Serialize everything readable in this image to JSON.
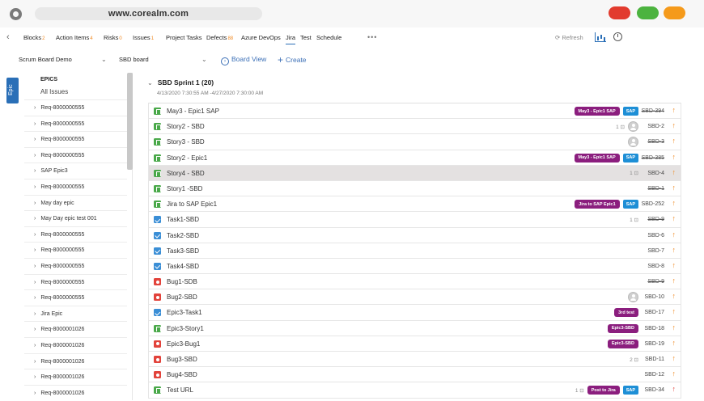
{
  "browser": {
    "url": "www.corealm.com"
  },
  "nav": {
    "back": "‹",
    "tabs": [
      {
        "label": "Blocks",
        "count": "2"
      },
      {
        "label": "Action Items",
        "count": "4"
      },
      {
        "label": "Risks",
        "count": "0"
      },
      {
        "label": "Issues",
        "count": "1"
      },
      {
        "label": "Project Tasks",
        "count": ""
      },
      {
        "label": "Defects",
        "count": "88"
      },
      {
        "label": "Azure DevOps",
        "count": ""
      },
      {
        "label": "Jira",
        "count": ""
      },
      {
        "label": "Test",
        "count": ""
      },
      {
        "label": "Schedule",
        "count": ""
      }
    ],
    "active_tab": "Jira",
    "more": "•••",
    "refresh": "Refresh"
  },
  "toolbar": {
    "project": "Scrum Board Demo",
    "board": "SBD board",
    "board_view": "Board View",
    "create": "Create"
  },
  "side_tab": "Epic",
  "epics": {
    "header": "EPICS",
    "all": "All Issues",
    "items": [
      "Req-8000000555",
      "Req-8000000555",
      "Req-8000000555",
      "Req-8000000555",
      "SAP Epic3",
      "Req-8000000555",
      "May day epic",
      "May Day epic test 001",
      "Req-8000000555",
      "Req-8000000555",
      "Req-8000000555",
      "Req-8000000555",
      "Req-8000000555",
      "Jira Epic",
      "Req-8000001026",
      "Req-8000001026",
      "Req-8000001026",
      "Req-8000001026",
      "Req-8000001026"
    ]
  },
  "sprint": {
    "title": "SBD Sprint 1 (20)",
    "dates": "4/13/2020 7:30:55 AM -4/27/2020 7:30:00 AM"
  },
  "issues": [
    {
      "type": "story",
      "summary": "May3 - Epic1 SAP",
      "epic": "May3 - Epic1 SAP",
      "sap": "SAP",
      "key": "SBD-394",
      "done": true,
      "prio": "↑"
    },
    {
      "type": "story",
      "summary": "Story2 - SBD",
      "sub": "1 ⊡",
      "avatar": true,
      "key": "SBD-2",
      "prio": "↑"
    },
    {
      "type": "story",
      "summary": "Story3 - SBD",
      "avatar": true,
      "key": "SBD-3",
      "done": true,
      "prio": "↑"
    },
    {
      "type": "story",
      "summary": "Story2 - Epic1",
      "epic": "May3 - Epic1 SAP",
      "sap": "SAP",
      "key": "SBD-385",
      "done": true,
      "prio": "↑"
    },
    {
      "type": "story",
      "summary": "Story4 - SBD",
      "sub": "1 ⊡",
      "key": "SBD-4",
      "prio": "↑",
      "selected": true
    },
    {
      "type": "story",
      "summary": "Story1 -SBD",
      "key": "SBD-1",
      "done": true,
      "prio": "↑"
    },
    {
      "type": "story",
      "summary": "Jira to SAP Epic1",
      "epic": "Jira to SAP Epic1",
      "sap": "SAP",
      "key": "SBD-252",
      "prio": "↑"
    },
    {
      "type": "task",
      "summary": "Task1-SBD",
      "sub": "1 ⊡",
      "key": "SBD-9",
      "done": true,
      "prio": "↑"
    },
    {
      "type": "task",
      "summary": "Task2-SBD",
      "key": "SBD-6",
      "prio": "↑"
    },
    {
      "type": "task",
      "summary": "Task3-SBD",
      "key": "SBD-7",
      "prio": "↑"
    },
    {
      "type": "task",
      "summary": "Task4-SBD",
      "key": "SBD-8",
      "prio": "↑"
    },
    {
      "type": "bug",
      "summary": "Bug1-SDB",
      "key": "SBD-9",
      "done": true,
      "prio": "↑"
    },
    {
      "type": "bug",
      "summary": "Bug2-SBD",
      "avatar": true,
      "key": "SBD-10",
      "prio": "↑"
    },
    {
      "type": "task",
      "summary": "Epic3-Task1",
      "epic": "3rd test",
      "key": "SBD-17",
      "prio": "↑"
    },
    {
      "type": "story",
      "summary": "Epic3-Story1",
      "epic": "Epic3-SBD",
      "key": "SBD-18",
      "prio": "↑"
    },
    {
      "type": "bug",
      "summary": "Epic3-Bug1",
      "epic": "Epic3-SBD",
      "key": "SBD-19",
      "prio": "↑"
    },
    {
      "type": "bug",
      "summary": "Bug3-SBD",
      "sub": "2 ⊡",
      "key": "SBD-11",
      "prio": "↑"
    },
    {
      "type": "bug",
      "summary": "Bug4-SBD",
      "key": "SBD-12",
      "prio": "↑"
    },
    {
      "type": "story",
      "summary": "Test URL",
      "epic": "Post to Jira",
      "sub": "1 ⊡",
      "sap": "SAP",
      "key": "SBD-34",
      "prio": "↑",
      "prio_red": true
    }
  ]
}
